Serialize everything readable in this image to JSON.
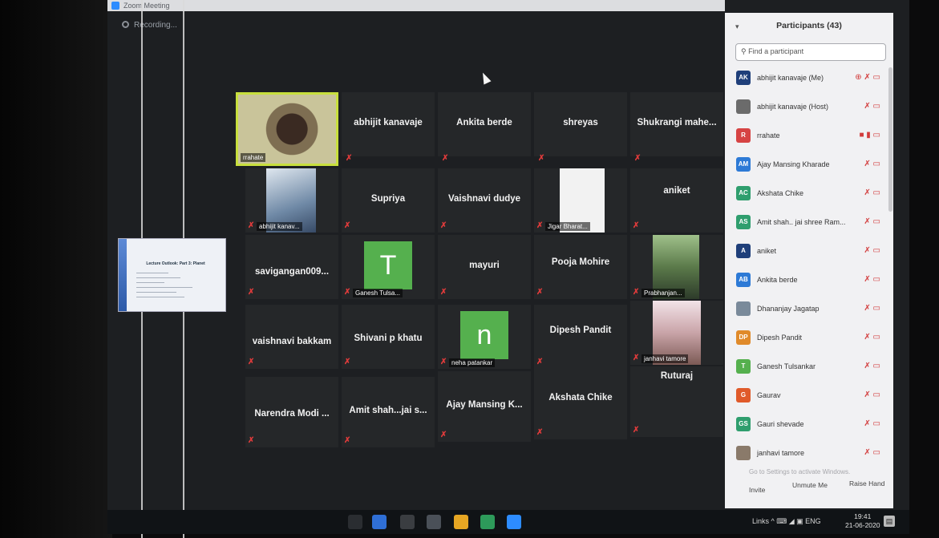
{
  "window": {
    "title": "Zoom Meeting"
  },
  "recording": {
    "label": "Recording..."
  },
  "shared_screen": {
    "title": "Lecture Outlook: Part 3: Planet"
  },
  "tiles": [
    {
      "name": "rrahate",
      "type": "video",
      "active": true
    },
    {
      "name": "abhijit kanavaje",
      "type": "name"
    },
    {
      "name": "Ankita berde",
      "type": "name"
    },
    {
      "name": "shreyas",
      "type": "name"
    },
    {
      "name": "Shukrangi mahe...",
      "type": "name"
    },
    {
      "name": "abhijit kanav...",
      "type": "video"
    },
    {
      "name": "Supriya",
      "type": "name"
    },
    {
      "name": "Vaishnavi dudye",
      "type": "name"
    },
    {
      "name": "Jigar Bharat...",
      "type": "video"
    },
    {
      "name": "aniket",
      "type": "name"
    },
    {
      "name": "savigangan009...",
      "type": "name"
    },
    {
      "name": "Ganesh Tulsa...",
      "type": "letter",
      "letter": "T"
    },
    {
      "name": "mayuri",
      "type": "name"
    },
    {
      "name": "Pooja Mohire",
      "type": "name"
    },
    {
      "name": "Prabhanjan...",
      "type": "video"
    },
    {
      "name": "vaishnavi bakkam",
      "type": "name"
    },
    {
      "name": "Shivani p khatu",
      "type": "name"
    },
    {
      "name": "neha patankar",
      "type": "letter",
      "letter": "n"
    },
    {
      "name": "Dipesh Pandit",
      "type": "name"
    },
    {
      "name": "janhavi tamore",
      "type": "video"
    },
    {
      "name": "Narendra Modi ...",
      "type": "name"
    },
    {
      "name": "Amit shah...jai s...",
      "type": "name"
    },
    {
      "name": "Ajay Mansing K...",
      "type": "name"
    },
    {
      "name": "Akshata Chike",
      "type": "name"
    },
    {
      "name": "Ruturaj",
      "type": "name"
    }
  ],
  "participants_panel": {
    "title": "Participants (43)",
    "search_placeholder": "Find a participant",
    "participants": [
      {
        "initials": "AK",
        "color": "#1f3f7a",
        "name": "abhijit kanavaje (Me)",
        "status": "⊕ ✗ ▭"
      },
      {
        "initials": "",
        "color": "#6b6b6b",
        "name": "abhijit kanavaje (Host)",
        "status": "✗ ▭"
      },
      {
        "initials": "R",
        "color": "#d64343",
        "name": "rrahate",
        "status": "■ ▮ ▭"
      },
      {
        "initials": "AM",
        "color": "#2d7ad6",
        "name": "Ajay Mansing Kharade",
        "status": "✗ ▭"
      },
      {
        "initials": "AC",
        "color": "#2f9e6e",
        "name": "Akshata Chike",
        "status": "✗ ▭"
      },
      {
        "initials": "AS",
        "color": "#2f9e6e",
        "name": "Amit shah.. jai shree Ram...",
        "status": "✗ ▭"
      },
      {
        "initials": "A",
        "color": "#1f3f7a",
        "name": "aniket",
        "status": "✗ ▭"
      },
      {
        "initials": "AB",
        "color": "#2d7ad6",
        "name": "Ankita berde",
        "status": "✗ ▭"
      },
      {
        "initials": "",
        "color": "#7a8a9a",
        "name": "Dhananjay Jagatap",
        "status": "✗ ▭"
      },
      {
        "initials": "DP",
        "color": "#e08a2a",
        "name": "Dipesh Pandit",
        "status": "✗ ▭"
      },
      {
        "initials": "T",
        "color": "#55b04e",
        "name": "Ganesh Tulsankar",
        "status": "✗ ▭"
      },
      {
        "initials": "G",
        "color": "#e05a2a",
        "name": "Gaurav",
        "status": "✗ ▭"
      },
      {
        "initials": "GS",
        "color": "#2f9e6e",
        "name": "Gauri shevade",
        "status": "✗ ▭"
      },
      {
        "initials": "",
        "color": "#8a7a6a",
        "name": "janhavi tamore",
        "status": "✗ ▭"
      }
    ],
    "watermark": "Go to Settings to activate Windows.",
    "invite_label": "Invite",
    "unmute_label": "Unmute Me",
    "raise_hand_label": "Raise Hand"
  },
  "taskbar": {
    "tray_text": "Links ^ ⌨ ◢ ▣ ENG",
    "time": "19:41",
    "date": "21-06-2020"
  }
}
